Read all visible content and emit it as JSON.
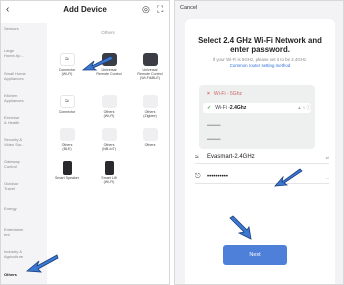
{
  "left": {
    "title": "Add Device",
    "back_icon": "chevron-left",
    "sidebar": [
      "Sensors",
      "Large\nHome Ap...",
      "Small Home\nAppliances",
      "Kitchen\nAppliances",
      "Exercise\n& Health",
      "Security &\nVideo Sur...",
      "Gateway\nControl",
      "Outdoor\nTravel",
      "Energy",
      "Entertainm\nent",
      "Industry &\nAgriculture",
      "Others"
    ],
    "category_label": "Others",
    "devices": [
      "Connector\n(Wi-Fi)",
      "Universal\nRemote Control",
      "Universal\nRemote Control\n(Wi-Fi&BLE)",
      "Connector",
      "Others\n(Wi-Fi)",
      "Others\n(Zigbee)",
      "Others\n(BLE)",
      "Others\n(NB-IoT)",
      "Others",
      "Smart Speaker",
      "Smart Lift\n(Wi-Fi)"
    ]
  },
  "right": {
    "cancel": "Cancel",
    "title": "Select 2.4 GHz Wi-Fi Network and enter password.",
    "subtitle": "If your Wi-Fi is 5GHz, please set it to be 2.4GHz.",
    "link": "Common router setting method",
    "wifi_list": {
      "bad": {
        "mark": "×",
        "name": "Wi-Fi - 5Ghz"
      },
      "good": {
        "mark": "✓",
        "name": "Wi-Fi - ",
        "band": "2.4Ghz"
      }
    },
    "ssid": "Evasmart-2.4GHz",
    "password": "••••••••••",
    "next_button": "Next"
  },
  "colors": {
    "primary_button": "#4e7fd9",
    "link": "#2d6fd6",
    "ok": "#3ca34a",
    "error": "#e05a5a",
    "arrow": "#3b78d4"
  }
}
